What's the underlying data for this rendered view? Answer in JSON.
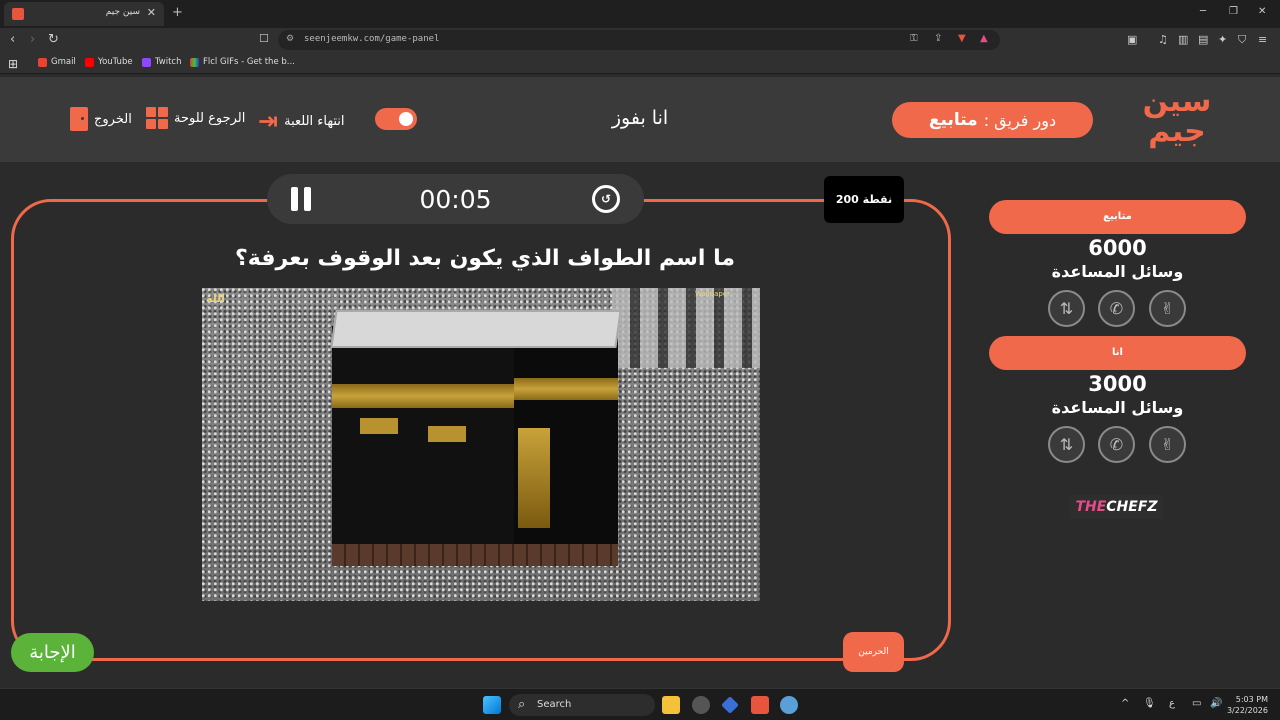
{
  "browser": {
    "tab_title": "سين جيم",
    "url": "seenjeemkw.com/game-panel",
    "bookmarks": [
      "Gmail",
      "YouTube",
      "Twitch",
      "Flcl GIFs - Get the b..."
    ]
  },
  "header": {
    "logo_text": "سين جيم",
    "turn_label": "دور فريق :",
    "turn_team": "متابيع",
    "game_name": "انا بفوز",
    "end_game_label": "انتهاء اللعبة",
    "back_to_board_label": "الرجوع للوحة",
    "exit_label": "الخروج"
  },
  "question_panel": {
    "timer": "00:05",
    "points": "200 نقطة",
    "question_text": "ما اسم الطواف الذي يكون بعد الوقوف بعرفة؟",
    "image_watermark": "Wallpaper",
    "image_logo": "الله",
    "answer_label": "الإجابة",
    "category_label": "الحرمين"
  },
  "teams": [
    {
      "name": "متابيع",
      "score": "6000",
      "aids_label": "وسائل المساعدة"
    },
    {
      "name": "انا",
      "score": "3000",
      "aids_label": "وسائل المساعدة"
    }
  ],
  "sponsor": {
    "prefix": "THE",
    "name": "CHEFZ"
  },
  "taskbar": {
    "search_placeholder": "Search",
    "time": "5:03 PM",
    "date": "3/22/2026",
    "lang": "ع"
  },
  "colors": {
    "accent": "#f0694a",
    "answer": "#5bb33a",
    "background": "#2b2b2b"
  }
}
